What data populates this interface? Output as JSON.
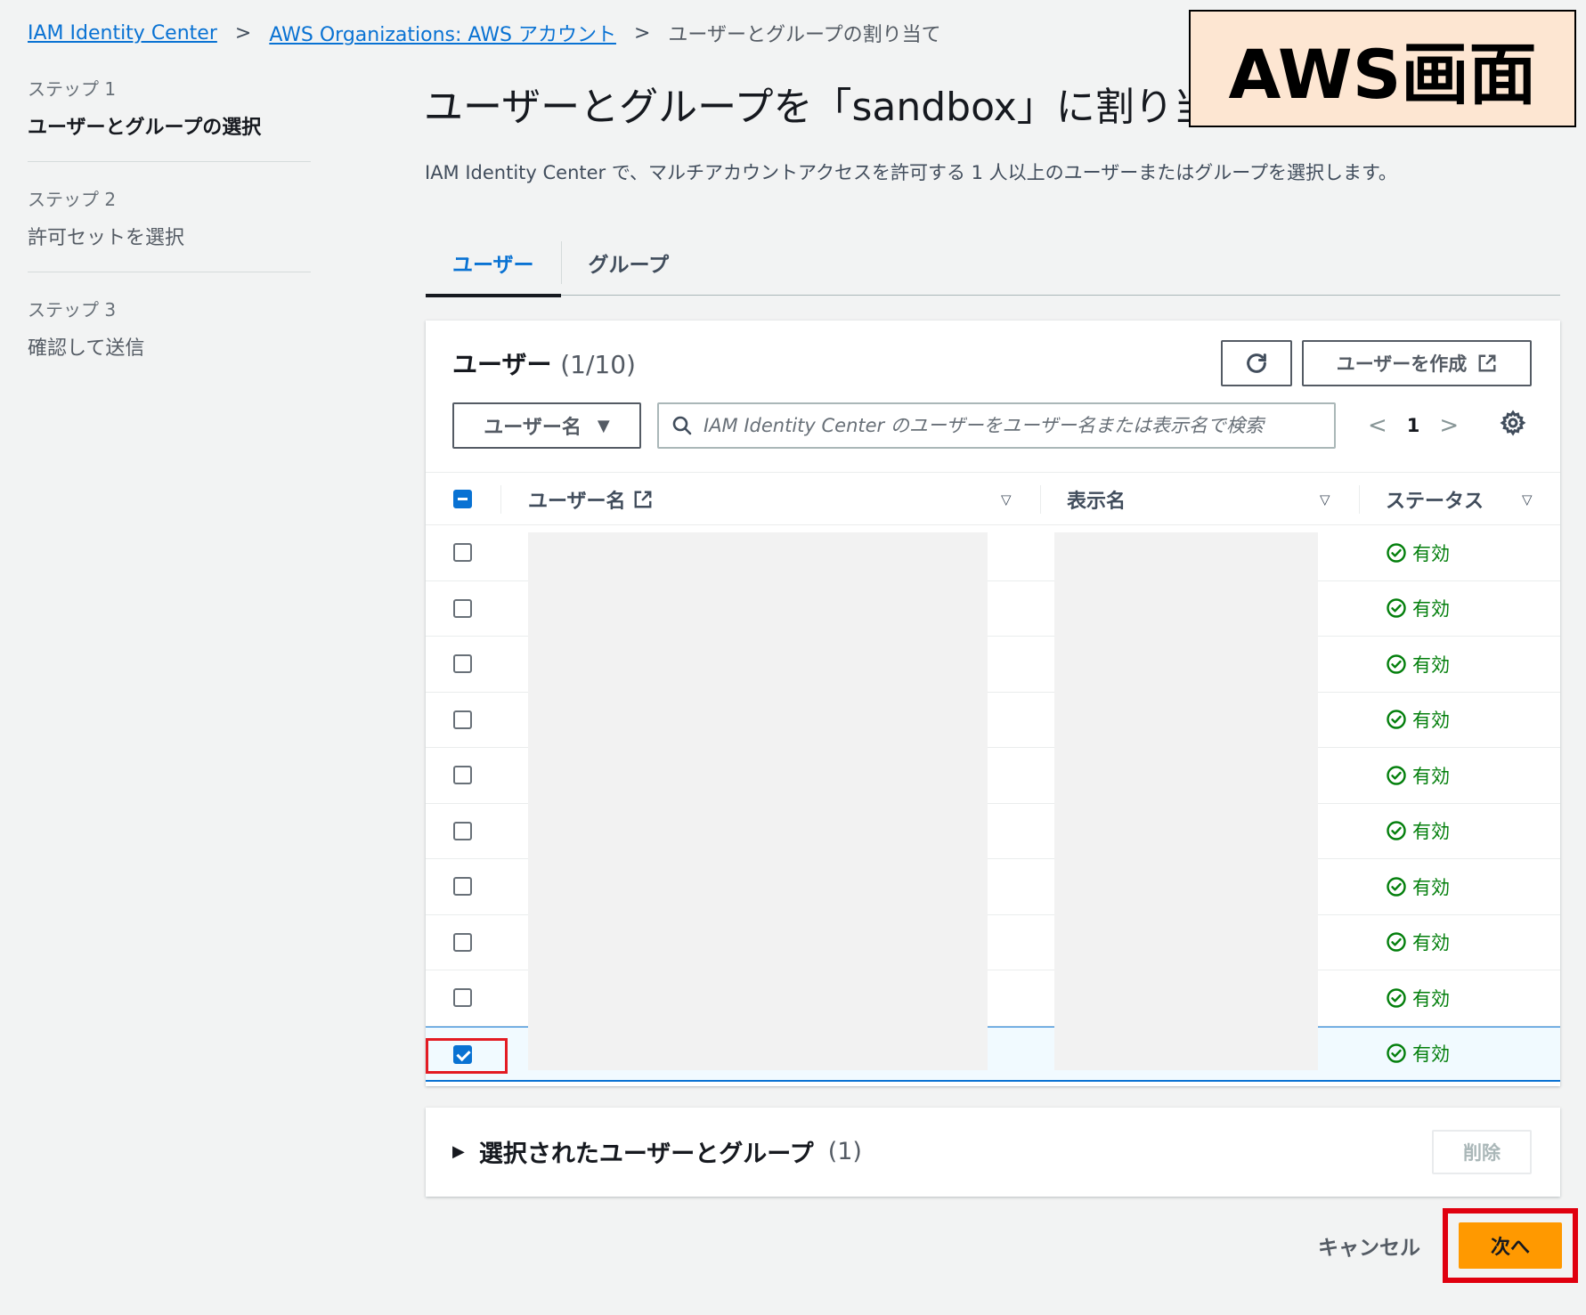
{
  "breadcrumb": [
    {
      "label": "IAM Identity Center",
      "link": true
    },
    {
      "label": "AWS Organizations: AWS アカウント",
      "link": true
    },
    {
      "label": "ユーザーとグループの割り当て",
      "link": false
    }
  ],
  "steps": [
    {
      "num": "ステップ 1",
      "name": "ユーザーとグループの選択",
      "active": true
    },
    {
      "num": "ステップ 2",
      "name": "許可セットを選択",
      "active": false
    },
    {
      "num": "ステップ 3",
      "name": "確認して送信",
      "active": false
    }
  ],
  "page_title": "ユーザーとグループを「sandbox」に割り当",
  "description": "IAM Identity Center で、マルチアカウントアクセスを許可する 1 人以上のユーザーまたはグループを選択します。",
  "tabs": [
    {
      "label": "ユーザー",
      "active": true
    },
    {
      "label": "グループ",
      "active": false
    }
  ],
  "users_panel": {
    "title": "ユーザー",
    "count": "(1/10)",
    "create_button": "ユーザーを作成",
    "filter_property": "ユーザー名",
    "search_placeholder": "IAM Identity Center のユーザーをユーザー名または表示名で検索",
    "current_page": "1"
  },
  "table": {
    "columns": [
      "ユーザー名",
      "表示名",
      "ステータス"
    ],
    "rows": [
      {
        "status": "有効",
        "checked": false
      },
      {
        "status": "有効",
        "checked": false
      },
      {
        "status": "有効",
        "checked": false
      },
      {
        "status": "有効",
        "checked": false
      },
      {
        "status": "有効",
        "checked": false
      },
      {
        "status": "有効",
        "checked": false
      },
      {
        "status": "有効",
        "checked": false
      },
      {
        "status": "有効",
        "checked": false
      },
      {
        "status": "有効",
        "checked": false
      },
      {
        "status": "有効",
        "checked": true
      }
    ]
  },
  "selected_section": {
    "title": "選択されたユーザーとグループ",
    "count": "(1)",
    "remove_button": "削除"
  },
  "footer": {
    "cancel": "キャンセル",
    "next": "次へ"
  },
  "overlay_label": "AWS画面",
  "colors": {
    "link": "#0972d3",
    "primary_button": "#ff9900",
    "status_ok": "#037f0c",
    "highlight": "#e0000f",
    "overlay_bg": "#fde6d2"
  }
}
